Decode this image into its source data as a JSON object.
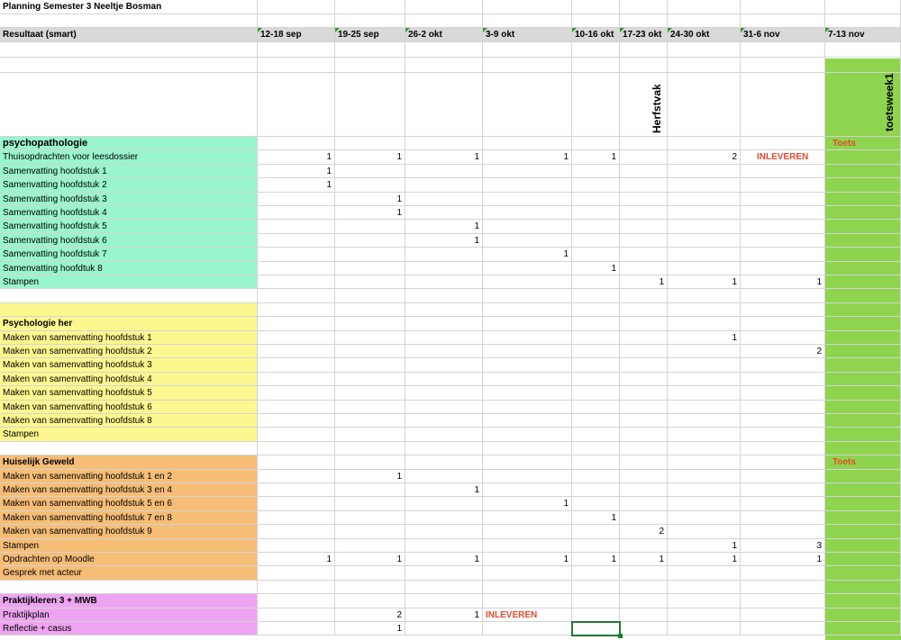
{
  "title": "Planning Semester 3 Neeltje Bosman",
  "header": {
    "label": "Resultaat (smart)",
    "weeks": [
      "12-18 sep",
      "19-25 sep",
      "26-2 okt",
      "3-9 okt",
      "10-16 okt",
      "17-23 okt",
      "24-30 okt",
      "31-6 nov",
      "7-13 nov"
    ]
  },
  "colors": {
    "psychopathologie": "#99f5cc",
    "psychologie_her": "#fdf78f",
    "huiselijk_geweld": "#f6bd76",
    "praktijkleren": "#eea4f0",
    "toetsweek": "#8fd44e",
    "header_bg": "#d9d9d9",
    "highlight_text": "#e34a2d"
  },
  "vertical_labels": {
    "herfstvak": "Herfstvak",
    "toetsweek": "toetsweek1"
  },
  "sections": [
    {
      "key": "psychopathologie",
      "title": "psychopathologie",
      "toets": "Toets",
      "rows": [
        {
          "label": "Thuisopdrachten voor leesdossier",
          "values": [
            "1",
            "1",
            "1",
            "1",
            "1",
            "",
            "2"
          ],
          "note": "INLEVEREN"
        },
        {
          "label": "Samenvatting hoofdstuk 1",
          "values": [
            "1",
            "",
            "",
            "",
            "",
            "",
            "",
            ""
          ]
        },
        {
          "label": "Samenvatting hoofdstuk 2",
          "values": [
            "1",
            "",
            "",
            "",
            "",
            "",
            "",
            ""
          ]
        },
        {
          "label": "Samenvatting hoofdstuk 3",
          "values": [
            "",
            "1",
            "",
            "",
            "",
            "",
            "",
            ""
          ]
        },
        {
          "label": "Samenvatting hoofdstuk 4",
          "values": [
            "",
            "1",
            "",
            "",
            "",
            "",
            "",
            ""
          ]
        },
        {
          "label": "Samenvatting hoofdstuk 5",
          "values": [
            "",
            "",
            "1",
            "",
            "",
            "",
            "",
            ""
          ]
        },
        {
          "label": "Samenvatting hoofdstuk 6",
          "values": [
            "",
            "",
            "1",
            "",
            "",
            "",
            "",
            ""
          ]
        },
        {
          "label": "Samenvatting hoofdstuk 7",
          "values": [
            "",
            "",
            "",
            "1",
            "",
            "",
            "",
            ""
          ]
        },
        {
          "label": "Samenvatting hoofdtuk 8",
          "values": [
            "",
            "",
            "",
            "",
            "1",
            "",
            "",
            ""
          ]
        },
        {
          "label": "Stampen",
          "values": [
            "",
            "",
            "",
            "",
            "",
            "1",
            "1",
            "1"
          ]
        }
      ]
    },
    {
      "key": "psychologie_her",
      "title": "Psychologie her",
      "rows": [
        {
          "label": "Maken van samenvatting hoofdstuk 1",
          "values": [
            "",
            "",
            "",
            "",
            "",
            "",
            "1",
            ""
          ]
        },
        {
          "label": "Maken van samenvatting hoofdstuk 2",
          "values": [
            "",
            "",
            "",
            "",
            "",
            "",
            "",
            "2"
          ]
        },
        {
          "label": "Maken van samenvatting hoofdstuk 3",
          "values": [
            "",
            "",
            "",
            "",
            "",
            "",
            "",
            ""
          ]
        },
        {
          "label": "Maken van samenvatting hoofdstuk 4",
          "values": [
            "",
            "",
            "",
            "",
            "",
            "",
            "",
            ""
          ]
        },
        {
          "label": "Maken van samenvatting hoofdstuk 5",
          "values": [
            "",
            "",
            "",
            "",
            "",
            "",
            "",
            ""
          ]
        },
        {
          "label": "Maken van samenvatting hoofdstuk 6",
          "values": [
            "",
            "",
            "",
            "",
            "",
            "",
            "",
            ""
          ]
        },
        {
          "label": "Maken van samenvatting hoofdstuk 8",
          "values": [
            "",
            "",
            "",
            "",
            "",
            "",
            "",
            ""
          ]
        },
        {
          "label": "Stampen",
          "values": [
            "",
            "",
            "",
            "",
            "",
            "",
            "",
            ""
          ]
        }
      ]
    },
    {
      "key": "huiselijk_geweld",
      "title": "Huiselijk Geweld",
      "toets": "Toets",
      "rows": [
        {
          "label": "Maken van samenvatting hoofdstuk 1 en 2",
          "values": [
            "",
            "1",
            "",
            "",
            "",
            "",
            "",
            ""
          ]
        },
        {
          "label": "Maken van samenvatting hoofdstuk 3 en 4",
          "values": [
            "",
            "",
            "1",
            "",
            "",
            "",
            "",
            ""
          ]
        },
        {
          "label": "Maken van samenvatting hoofdstuk 5 en 6",
          "values": [
            "",
            "",
            "",
            "1",
            "",
            "",
            "",
            ""
          ]
        },
        {
          "label": "Maken van samenvatting hoofdstuk 7 en 8",
          "values": [
            "",
            "",
            "",
            "",
            "1",
            "",
            "",
            ""
          ]
        },
        {
          "label": "Maken van samenvatting hoofdstuk 9",
          "values": [
            "",
            "",
            "",
            "",
            "",
            "2",
            "",
            ""
          ]
        },
        {
          "label": "Stampen",
          "values": [
            "",
            "",
            "",
            "",
            "",
            "",
            "1",
            "3"
          ]
        },
        {
          "label": "Opdrachten op Moodle",
          "values": [
            "1",
            "1",
            "1",
            "1",
            "1",
            "1",
            "1",
            "1"
          ]
        },
        {
          "label": "Gesprek met acteur",
          "values": [
            "",
            "",
            "",
            "",
            "",
            "",
            "",
            ""
          ]
        }
      ]
    },
    {
      "key": "praktijkleren",
      "title": "Praktijkleren 3 + MWB",
      "rows": [
        {
          "label": "Praktijkplan",
          "values": [
            "",
            "2",
            "1"
          ],
          "note": "INLEVEREN"
        },
        {
          "label": "Reflectie + casus",
          "values": [
            "",
            "1",
            "",
            "",
            "",
            "",
            "",
            ""
          ]
        }
      ]
    }
  ]
}
